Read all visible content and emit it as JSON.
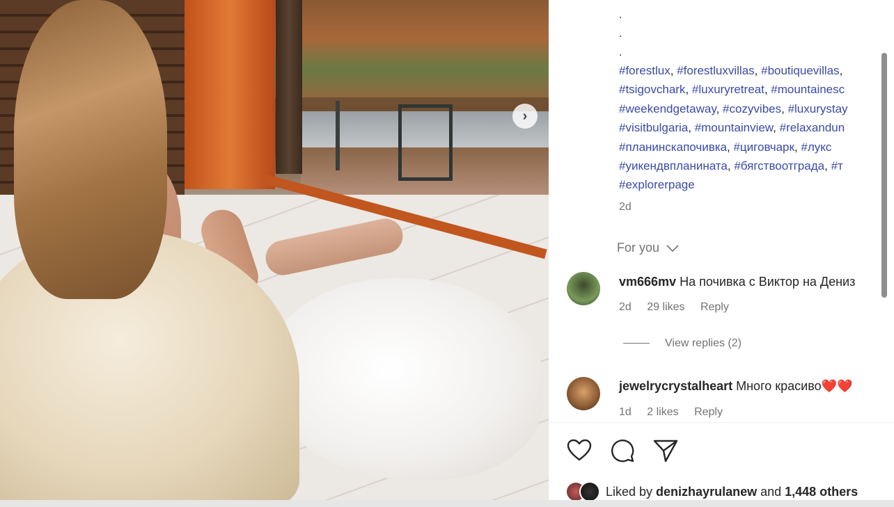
{
  "post_dots": [
    ".",
    ".",
    "."
  ],
  "hashtag_lines": [
    [
      {
        "tag": "#forestlux",
        "sep": ", "
      },
      {
        "tag": "#forestluxvillas",
        "sep": ", "
      },
      {
        "tag": "#boutiquevillas",
        "sep": ","
      }
    ],
    [
      {
        "tag": "#tsigovchark",
        "sep": ", "
      },
      {
        "tag": "#luxuryretreat",
        "sep": ", "
      },
      {
        "tag": "#mountainesc",
        "sep": ""
      }
    ],
    [
      {
        "tag": "#weekendgetaway",
        "sep": ", "
      },
      {
        "tag": "#cozyvibes",
        "sep": ", "
      },
      {
        "tag": "#luxurystay",
        "sep": ""
      }
    ],
    [
      {
        "tag": "#visitbulgaria",
        "sep": ", "
      },
      {
        "tag": "#mountainview",
        "sep": ", "
      },
      {
        "tag": "#relaxandun",
        "sep": ""
      }
    ],
    [
      {
        "tag": "#планинскапочивка",
        "sep": ", "
      },
      {
        "tag": "#циговчарк",
        "sep": ", "
      },
      {
        "tag": "#лукс",
        "sep": ""
      }
    ],
    [
      {
        "tag": "#уикендвпланината",
        "sep": ", "
      },
      {
        "tag": "#бягствоотграда",
        "sep": ", "
      },
      {
        "tag": "#т",
        "sep": ""
      }
    ],
    [
      {
        "tag": "#explorerpage",
        "sep": ""
      }
    ]
  ],
  "post_age": "2d",
  "for_you_label": "For you",
  "comments": [
    {
      "username": "vm666mv",
      "text": "На почивка с Виктор на Дениз",
      "age": "2d",
      "likes": "29 likes",
      "reply_label": "Reply"
    },
    {
      "username": "jewelrycrystalheart",
      "text": "Много красиво",
      "emoji": "❤️❤️",
      "age": "1d",
      "likes": "2 likes",
      "reply_label": "Reply"
    }
  ],
  "view_replies_label": "View replies (2)",
  "liked_by": {
    "prefix": "Liked by ",
    "user": "denizhayrulanew",
    "middle": " and ",
    "count": "1,448 others"
  },
  "icons": {
    "next": "chevron-right-icon",
    "like": "heart-outline-icon",
    "comment": "speech-bubble-icon",
    "share": "paper-plane-icon",
    "for_you": "chevron-down-icon"
  },
  "colors": {
    "hashtag": "#3a4aa8",
    "muted": "#737373",
    "text": "#262626",
    "heart": "#e0202f"
  }
}
